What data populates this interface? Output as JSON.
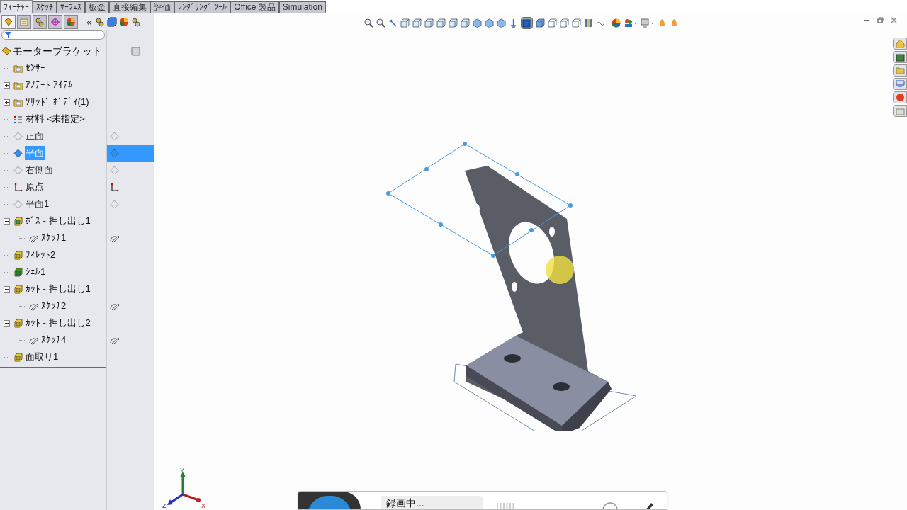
{
  "command_tabs": [
    {
      "label": "ﾌｨｰﾁｬｰ",
      "selected": true
    },
    {
      "label": "ｽｹｯﾁ",
      "selected": false
    },
    {
      "label": "ｻｰﾌｪｽ",
      "selected": false
    },
    {
      "label": "板金",
      "selected": false
    },
    {
      "label": "直接編集",
      "selected": false
    },
    {
      "label": "評価",
      "selected": false
    },
    {
      "label": "ﾚﾝﾀﾞﾘﾝｸﾞ ﾂｰﾙ",
      "selected": false
    },
    {
      "label": "Office 製品",
      "selected": false
    },
    {
      "label": "Simulation",
      "selected": false
    }
  ],
  "panel_tabs": [
    {
      "kind": "feature",
      "selected": true
    },
    {
      "kind": "property",
      "selected": false
    },
    {
      "kind": "config",
      "selected": false
    },
    {
      "kind": "dimxpert",
      "selected": false
    },
    {
      "kind": "display",
      "selected": false
    }
  ],
  "panel_collapse": "«",
  "tree": {
    "label": "モーターブラケット",
    "children": [
      {
        "label": "ｾﾝｻｰ",
        "kind": "sensor",
        "selected": false
      },
      {
        "label": "ｱﾉﾃｰﾄ ｱｲﾃﾑ",
        "kind": "annotation",
        "selected": false,
        "expanded": false
      },
      {
        "label": "ｿﾘｯﾄﾞ ﾎﾞﾃﾞｨ(1)",
        "kind": "body",
        "selected": false,
        "expanded": false
      },
      {
        "label": "材料 <未指定>",
        "kind": "material",
        "selected": false
      },
      {
        "label": "正面",
        "kind": "plane",
        "selected": false
      },
      {
        "label": "平面",
        "kind": "plane",
        "selected": true
      },
      {
        "label": "右側面",
        "kind": "plane",
        "selected": false
      },
      {
        "label": "原点",
        "kind": "origin",
        "selected": false
      },
      {
        "label": "平面1",
        "kind": "plane",
        "selected": false
      },
      {
        "label": "ﾎﾞｽ - 押し出し1",
        "kind": "extrude",
        "selected": false,
        "expanded": true,
        "children": [
          {
            "label": "ｽｹｯﾁ1",
            "kind": "sketch",
            "selected": false
          }
        ]
      },
      {
        "label": "ﾌｨﾚｯﾄ2",
        "kind": "fillet",
        "selected": false
      },
      {
        "label": "ｼｪﾙ1",
        "kind": "shell",
        "selected": false
      },
      {
        "label": "ｶｯﾄ - 押し出し1",
        "kind": "cut",
        "selected": false,
        "expanded": true,
        "children": [
          {
            "label": "ｽｹｯﾁ2",
            "kind": "sketch",
            "selected": false
          }
        ]
      },
      {
        "label": "ｶｯﾄ - 押し出し2",
        "kind": "cut",
        "selected": false,
        "expanded": true,
        "children": [
          {
            "label": "ｽｹｯﾁ4",
            "kind": "sketch",
            "selected": false
          }
        ]
      },
      {
        "label": "面取り1",
        "kind": "chamfer",
        "selected": false
      }
    ]
  },
  "triad": {
    "x": "X",
    "y": "Y",
    "z": "Z"
  },
  "recorder": {
    "status": "録画中..."
  }
}
